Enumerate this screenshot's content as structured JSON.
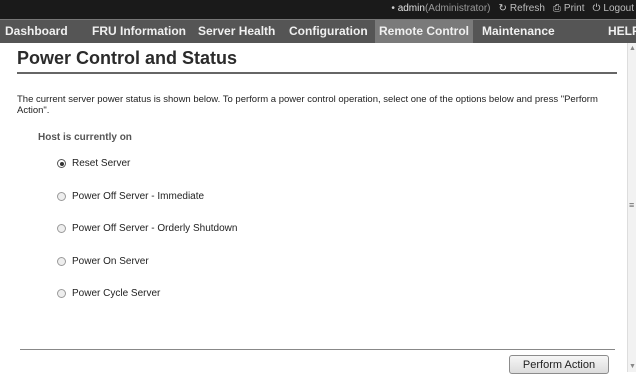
{
  "topbar": {
    "user": "admin",
    "role": "(Administrator)",
    "refresh_label": "Refresh",
    "print_label": "Print",
    "logout_label": "Logout"
  },
  "nav": {
    "tabs": [
      {
        "label": "Dashboard"
      },
      {
        "label": "FRU Information"
      },
      {
        "label": "Server Health"
      },
      {
        "label": "Configuration"
      },
      {
        "label": "Remote Control"
      },
      {
        "label": "Maintenance"
      },
      {
        "label": "HELP"
      }
    ],
    "active": "Remote Control"
  },
  "page": {
    "title": "Power Control and Status",
    "description": "The current server power status is shown below. To perform a power control operation, select one of the options below and press \"Perform Action\".",
    "status": "Host is currently on"
  },
  "options": [
    {
      "label": "Reset Server",
      "selected": true
    },
    {
      "label": "Power Off Server - Immediate",
      "selected": false
    },
    {
      "label": "Power Off Server - Orderly Shutdown",
      "selected": false
    },
    {
      "label": "Power On Server",
      "selected": false
    },
    {
      "label": "Power Cycle Server",
      "selected": false
    }
  ],
  "actions": {
    "perform_label": "Perform Action"
  }
}
